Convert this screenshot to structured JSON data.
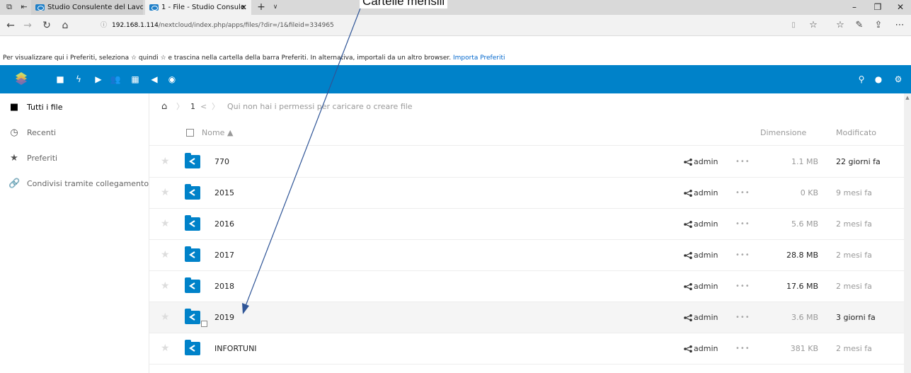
{
  "browser": {
    "tabs": [
      {
        "label": "Studio Consulente del Lavoı",
        "active": false
      },
      {
        "label": "1 - File - Studio Consule",
        "active": true
      }
    ],
    "address": {
      "url_host": "192.168.1.114",
      "url_path": "/nextcloud/index.php/apps/files/?dir=/1&fileid=334965"
    },
    "favorites_bar": {
      "message": "Per visualizzare qui i Preferiti, seleziona ☆ quindi ☆ e trascina nella cartella della barra Preferiti. In alternativa, importali da un altro browser.",
      "import_link": "Importa Preferiti"
    }
  },
  "sidebar": {
    "items": [
      {
        "label": "Tutti i file",
        "icon": "folder-icon",
        "active": true
      },
      {
        "label": "Recenti",
        "icon": "clock-icon",
        "active": false
      },
      {
        "label": "Preferiti",
        "icon": "star-icon",
        "active": false
      },
      {
        "label": "Condivisi tramite collegamento",
        "icon": "link-icon",
        "active": false
      }
    ]
  },
  "breadcrumb": {
    "current": "1",
    "notice": "Qui non hai i permessi per caricare o creare file"
  },
  "table": {
    "headers": {
      "name": "Nome ▲",
      "size": "Dimensione",
      "modified": "Modificato"
    },
    "rows": [
      {
        "name": "770",
        "owner": "admin",
        "size": "1.1 MB",
        "modified": "22 giorni fa",
        "size_bold": false,
        "mod_bold": true
      },
      {
        "name": "2015",
        "owner": "admin",
        "size": "0 KB",
        "modified": "9 mesi fa",
        "size_bold": false,
        "mod_bold": false
      },
      {
        "name": "2016",
        "owner": "admin",
        "size": "5.6 MB",
        "modified": "2 mesi fa",
        "size_bold": false,
        "mod_bold": false
      },
      {
        "name": "2017",
        "owner": "admin",
        "size": "28.8 MB",
        "modified": "2 mesi fa",
        "size_bold": true,
        "mod_bold": false
      },
      {
        "name": "2018",
        "owner": "admin",
        "size": "17.6 MB",
        "modified": "2 mesi fa",
        "size_bold": true,
        "mod_bold": false
      },
      {
        "name": "2019",
        "owner": "admin",
        "size": "3.6 MB",
        "modified": "3 giorni fa",
        "size_bold": false,
        "mod_bold": true
      },
      {
        "name": "INFORTUNI",
        "owner": "admin",
        "size": "381 KB",
        "modified": "2 mesi fa",
        "size_bold": false,
        "mod_bold": false
      }
    ]
  },
  "annotation": {
    "label": "Cartelle mensili"
  },
  "colors": {
    "nc_blue": "#0082c9"
  }
}
